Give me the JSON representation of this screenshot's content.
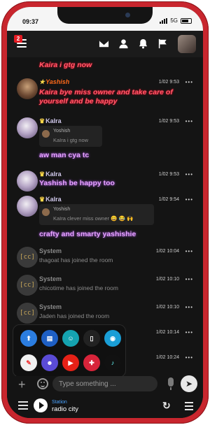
{
  "status_bar": {
    "time": "09:37",
    "network": "5G"
  },
  "nav": {
    "notification_count": "2"
  },
  "messages": [
    {
      "user": "",
      "text": "Kaira i gtg now",
      "time": "",
      "menu": "•••"
    },
    {
      "user": "Yashish",
      "text": "Kaira bye miss owner and take care of yourself and be happy",
      "time": "1/02 9:53",
      "menu": "•••"
    },
    {
      "user": "KaIra",
      "quote_user": "Yoshish",
      "quote_text": "KaIra i gtg now",
      "text": "aw man cya tc",
      "time": "1/02 9:53",
      "menu": "•••"
    },
    {
      "user": "KaIra",
      "text": "Yashish be happy too",
      "time": "1/02 9:53",
      "menu": "•••"
    },
    {
      "user": "KaIra",
      "quote_user": "Yoshish",
      "quote_text": "KaIra clever miss owner 😄 😂 🙌",
      "text": "crafty and smarty yashishie",
      "time": "1/02 9:54",
      "menu": "•••"
    },
    {
      "user": "System",
      "text": "thagoat has joined the room",
      "time": "1/02 10:04",
      "menu": "•••",
      "avatar": "[cc]"
    },
    {
      "user": "System",
      "text": "chicotime has joined the room",
      "time": "1/02 10:10",
      "menu": "•••",
      "avatar": "[cc]"
    },
    {
      "user": "System",
      "text": "Jaden has joined the room",
      "time": "1/02 10:10",
      "menu": "•••",
      "avatar": "[cc]"
    },
    {
      "user": "",
      "text": "",
      "time": "1/02 10:14",
      "menu": "•••"
    },
    {
      "user": "",
      "text": "",
      "time": "1/02 10:24",
      "menu": "•••"
    }
  ],
  "composer": {
    "placeholder": "Type something ...",
    "plus": "+",
    "send": "➤"
  },
  "radio": {
    "station_label": "Station",
    "station_name": "radio city",
    "refresh": "↻"
  },
  "colors": {
    "frame": "#c8262e",
    "screen": "#141414",
    "yashish_name": "#ff6a1a",
    "accent_blue": "#4aa3ff"
  }
}
